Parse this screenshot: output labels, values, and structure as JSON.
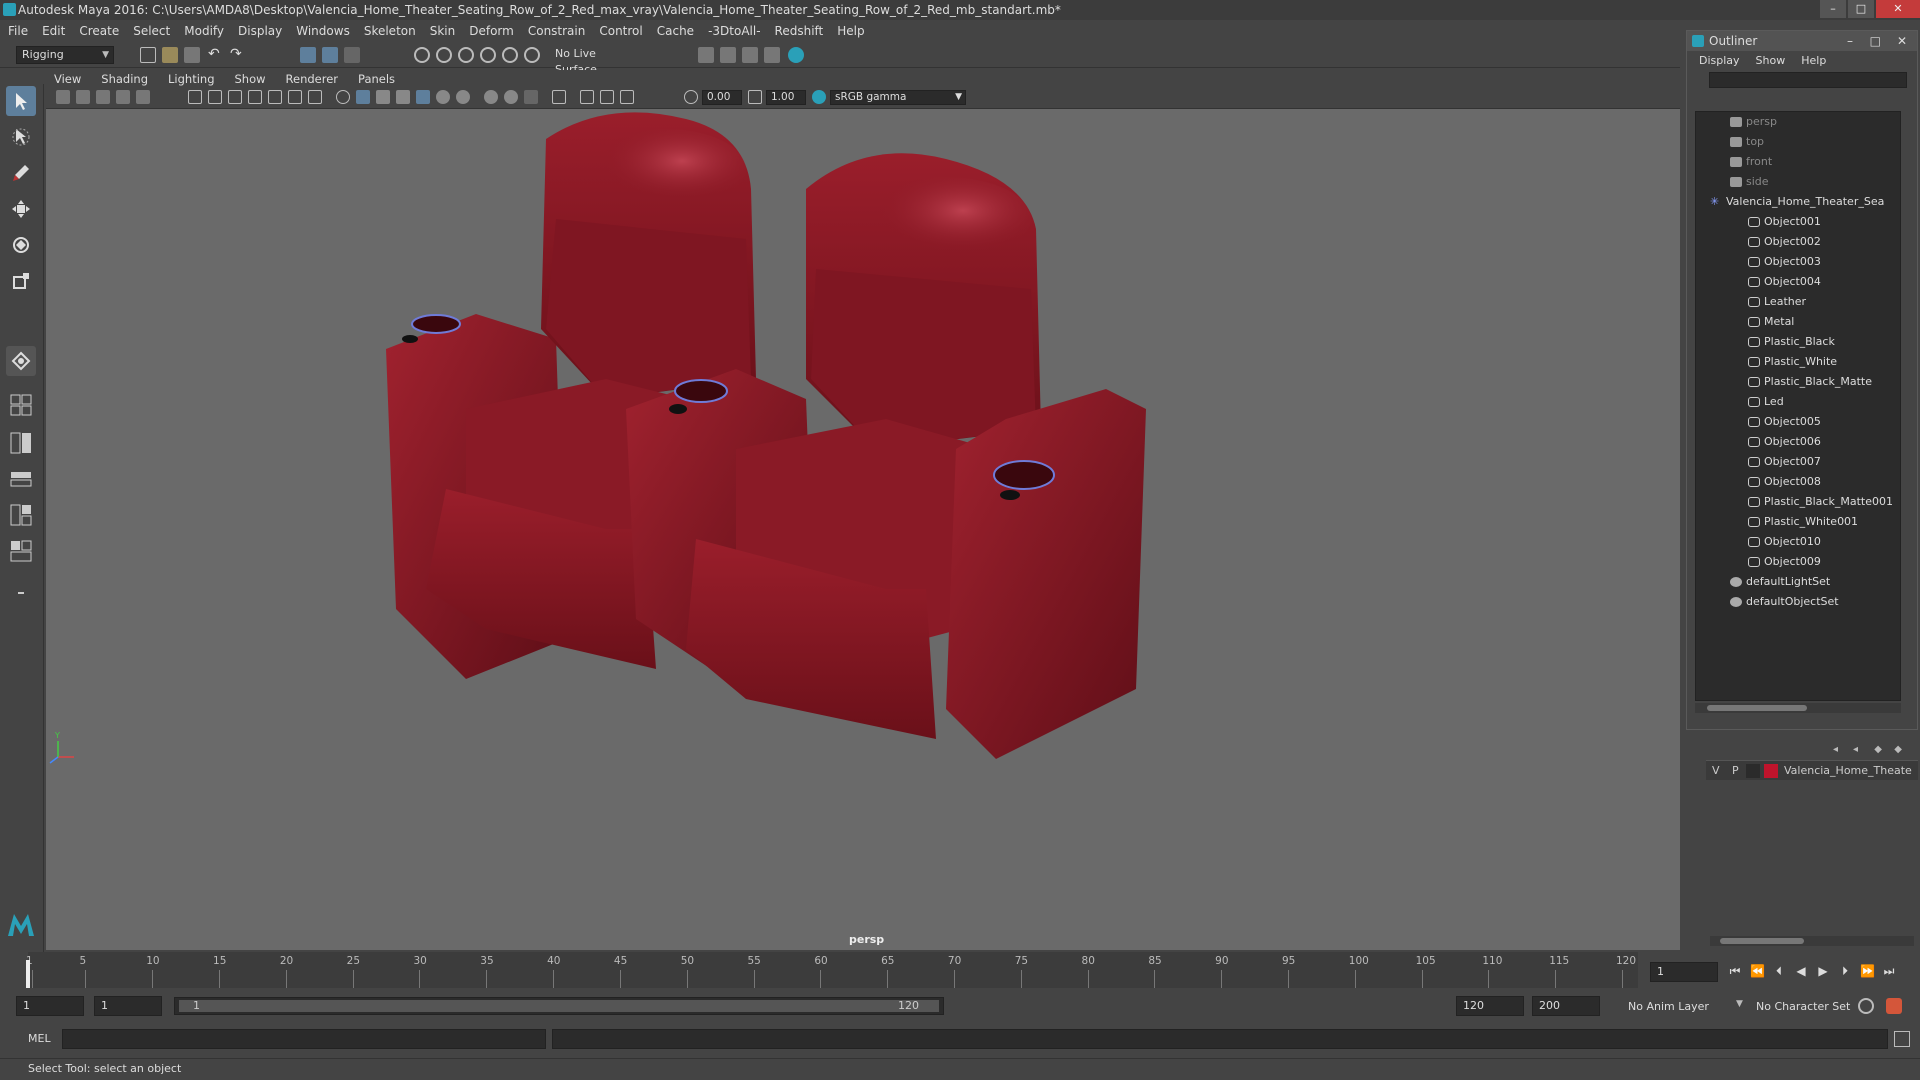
{
  "window": {
    "title": "Autodesk Maya 2016: C:\\Users\\AMDA8\\Desktop\\Valencia_Home_Theater_Seating_Row_of_2_Red_max_vray\\Valencia_Home_Theater_Seating_Row_of_2_Red_mb_standart.mb*",
    "minimize": "–",
    "maximize": "□",
    "close": "✕"
  },
  "menubar": [
    "File",
    "Edit",
    "Create",
    "Select",
    "Modify",
    "Display",
    "Windows",
    "Skeleton",
    "Skin",
    "Deform",
    "Constrain",
    "Control",
    "Cache",
    "-3DtoAll-",
    "Redshift",
    "Help"
  ],
  "shelf": {
    "mode": "Rigging",
    "live_surface": "No Live Surface"
  },
  "panel_menu": [
    "View",
    "Shading",
    "Lighting",
    "Show",
    "Renderer",
    "Panels"
  ],
  "panel_toolbar": {
    "exposure": "0.00",
    "gamma": "1.00",
    "color_space": "sRGB gamma"
  },
  "viewport": {
    "camera_label": "persp",
    "axis_y": "Y"
  },
  "outliner": {
    "title": "Outliner",
    "menu": [
      "Display",
      "Show",
      "Help"
    ],
    "items": [
      {
        "label": "persp",
        "type": "camera",
        "indent": 0
      },
      {
        "label": "top",
        "type": "camera",
        "indent": 0
      },
      {
        "label": "front",
        "type": "camera",
        "indent": 0
      },
      {
        "label": "side",
        "type": "camera",
        "indent": 0
      },
      {
        "label": "Valencia_Home_Theater_Sea",
        "type": "group",
        "indent": 0
      },
      {
        "label": "Object001",
        "type": "mesh",
        "indent": 1
      },
      {
        "label": "Object002",
        "type": "mesh",
        "indent": 1
      },
      {
        "label": "Object003",
        "type": "mesh",
        "indent": 1
      },
      {
        "label": "Object004",
        "type": "mesh",
        "indent": 1
      },
      {
        "label": "Leather",
        "type": "mesh",
        "indent": 1
      },
      {
        "label": "Metal",
        "type": "mesh",
        "indent": 1
      },
      {
        "label": "Plastic_Black",
        "type": "mesh",
        "indent": 1
      },
      {
        "label": "Plastic_White",
        "type": "mesh",
        "indent": 1
      },
      {
        "label": "Plastic_Black_Matte",
        "type": "mesh",
        "indent": 1
      },
      {
        "label": "Led",
        "type": "mesh",
        "indent": 1
      },
      {
        "label": "Object005",
        "type": "mesh",
        "indent": 1
      },
      {
        "label": "Object006",
        "type": "mesh",
        "indent": 1
      },
      {
        "label": "Object007",
        "type": "mesh",
        "indent": 1
      },
      {
        "label": "Object008",
        "type": "mesh",
        "indent": 1
      },
      {
        "label": "Plastic_Black_Matte001",
        "type": "mesh",
        "indent": 1
      },
      {
        "label": "Plastic_White001",
        "type": "mesh",
        "indent": 1
      },
      {
        "label": "Object010",
        "type": "mesh",
        "indent": 1
      },
      {
        "label": "Object009",
        "type": "mesh",
        "indent": 1
      },
      {
        "label": "defaultLightSet",
        "type": "set",
        "indent": 0
      },
      {
        "label": "defaultObjectSet",
        "type": "set",
        "indent": 0
      }
    ]
  },
  "layer_editor": {
    "v": "V",
    "p": "P",
    "layer_name": "Valencia_Home_Theate",
    "layer_color": "#c0142c"
  },
  "timeline": {
    "ticks": [
      "1",
      "5",
      "10",
      "15",
      "20",
      "25",
      "30",
      "35",
      "40",
      "45",
      "50",
      "55",
      "60",
      "65",
      "70",
      "75",
      "80",
      "85",
      "90",
      "95",
      "100",
      "105",
      "110",
      "115",
      "120"
    ],
    "current_frame": "1"
  },
  "range": {
    "start": "1",
    "anim_start": "1",
    "slider_start": "1",
    "slider_end": "120",
    "end": "120",
    "anim_end": "200",
    "anim_layer": "No Anim Layer",
    "character_set": "No Character Set"
  },
  "command_line": {
    "lang": "MEL"
  },
  "help_line": "Select Tool: select an object",
  "colors": {
    "chair_red": "#8a1a26",
    "accent_blue": "#5e7f9c"
  }
}
